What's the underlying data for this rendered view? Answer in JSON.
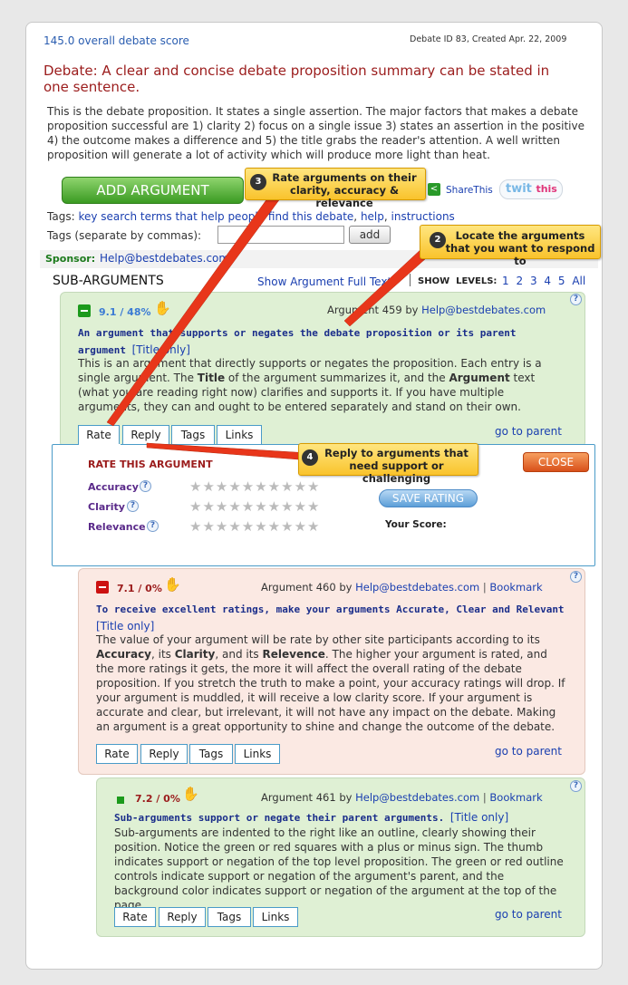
{
  "header": {
    "score": "145.0 overall debate score",
    "debate_id": "Debate ID 83, Created Apr. 22, 2009"
  },
  "debate": {
    "title": "Debate: A clear and concise debate proposition summary can be stated in one sentence.",
    "description": "This is the debate proposition. It states a single assertion. The major factors that makes a debate proposition successful are 1) clarity 2) focus on a single issue 3) states an assertion in the positive 4) the outcome makes a difference and 5) the title grabs the reader's attention. A well written proposition will generate a lot of activity which will produce more light than heat."
  },
  "toolbar": {
    "add_argument": "ADD ARGUMENT",
    "share": "ShareThis",
    "twit": "twit",
    "twit_this": "this"
  },
  "tags": {
    "label": "Tags:",
    "items": [
      "key search terms that help people find this debate",
      "help",
      "instructions"
    ],
    "input_label": "Tags (separate by commas):",
    "add_button": "add"
  },
  "sponsor": {
    "label": "Sponsor:",
    "value": "Help@bestdebates.com"
  },
  "subargs": {
    "heading": "SUB-ARGUMENTS",
    "show_full": "Show Argument Full Text",
    "show_levels": "SHOW  LEVELS:",
    "levels": [
      "1",
      "2",
      "3",
      "4",
      "5",
      "All"
    ]
  },
  "tabs": {
    "rate": "Rate",
    "reply": "Reply",
    "tags": "Tags",
    "links": "Links",
    "parent": "go to parent",
    "title_only": "[Title only]",
    "bookmark": "Bookmark",
    "by": "by"
  },
  "arg459": {
    "score": "9.1 / 48%",
    "meta": "Argument 459 by",
    "author": "Help@bestdebates.com",
    "title": "An argument that supports or negates the debate proposition or its parent argument",
    "body_html": "This is an argument that directly supports or negates the proposition. Each entry is a single argument. The <b>Title</b> of the argument summarizes it, and the <b>Argument</b> text (what you are reading right now) clarifies and supports it. If you have multiple arguments, they can and ought to be entered separately and stand on their own."
  },
  "rate_panel": {
    "title": "RATE THIS ARGUMENT",
    "accuracy": "Accuracy",
    "clarity": "Clarity",
    "relevance": "Relevance",
    "save": "SAVE RATING",
    "your_score": "Your Score:",
    "close": "CLOSE"
  },
  "arg460": {
    "score": "7.1 / 0%",
    "meta": "Argument 460 by",
    "author": "Help@bestdebates.com",
    "title": "To receive excellent ratings, make your arguments Accurate, Clear and Relevant",
    "body_html": "The value of your argument will be rate by other site participants according to its <b>Accuracy</b>, its <b>Clarity</b>, and its <b>Relevence</b>. The higher your argument is rated, and the more ratings it gets, the more it will affect the overall rating of the debate proposition. If you stretch the truth to make a point, your accuracy ratings will drop. If your argument is muddled, it will receive a low clarity score. If your argument is accurate and clear, but irrelevant, it will not have any impact on the debate. Making an argument is a great opportunity to shine and change the outcome of the debate."
  },
  "arg461": {
    "score": "7.2 / 0%",
    "meta": "Argument 461 by",
    "author": "Help@bestdebates.com",
    "title": "Sub-arguments support or negate their parent arguments.",
    "body": "Sub-arguments are indented to the right like an outline, clearly showing their position. Notice the green or red squares with a plus or minus sign. The thumb indicates support or negation of the top level proposition. The green or red outline controls indicate support or negation of the argument's parent, and the background color indicates support or negation of the argument at the top of the page."
  },
  "callouts": {
    "c2_num": "2",
    "c2": "Locate the arguments that you want to respond to",
    "c3_num": "3",
    "c3": "Rate arguments on their clarity, accuracy & relevance",
    "c4_num": "4",
    "c4": "Reply to arguments that need support or challenging"
  },
  "colors": {
    "title_red": "#9b1c1c",
    "link_blue": "#1a3fb0",
    "green_bg": "#dff0d4",
    "red_bg": "#fbe9e3",
    "callout": "#f9c32c"
  }
}
